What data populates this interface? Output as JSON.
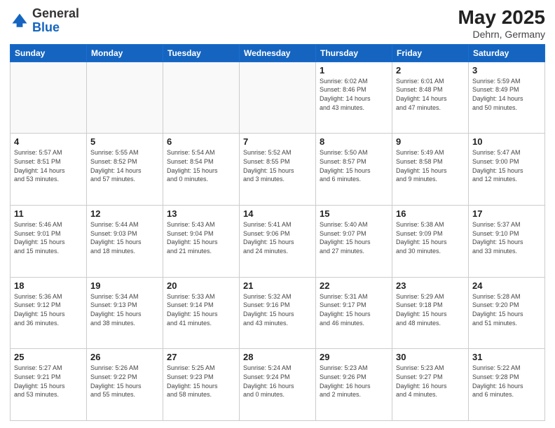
{
  "header": {
    "logo_general": "General",
    "logo_blue": "Blue",
    "month": "May 2025",
    "location": "Dehrn, Germany"
  },
  "weekdays": [
    "Sunday",
    "Monday",
    "Tuesday",
    "Wednesday",
    "Thursday",
    "Friday",
    "Saturday"
  ],
  "weeks": [
    [
      {
        "day": "",
        "info": ""
      },
      {
        "day": "",
        "info": ""
      },
      {
        "day": "",
        "info": ""
      },
      {
        "day": "",
        "info": ""
      },
      {
        "day": "1",
        "info": "Sunrise: 6:02 AM\nSunset: 8:46 PM\nDaylight: 14 hours\nand 43 minutes."
      },
      {
        "day": "2",
        "info": "Sunrise: 6:01 AM\nSunset: 8:48 PM\nDaylight: 14 hours\nand 47 minutes."
      },
      {
        "day": "3",
        "info": "Sunrise: 5:59 AM\nSunset: 8:49 PM\nDaylight: 14 hours\nand 50 minutes."
      }
    ],
    [
      {
        "day": "4",
        "info": "Sunrise: 5:57 AM\nSunset: 8:51 PM\nDaylight: 14 hours\nand 53 minutes."
      },
      {
        "day": "5",
        "info": "Sunrise: 5:55 AM\nSunset: 8:52 PM\nDaylight: 14 hours\nand 57 minutes."
      },
      {
        "day": "6",
        "info": "Sunrise: 5:54 AM\nSunset: 8:54 PM\nDaylight: 15 hours\nand 0 minutes."
      },
      {
        "day": "7",
        "info": "Sunrise: 5:52 AM\nSunset: 8:55 PM\nDaylight: 15 hours\nand 3 minutes."
      },
      {
        "day": "8",
        "info": "Sunrise: 5:50 AM\nSunset: 8:57 PM\nDaylight: 15 hours\nand 6 minutes."
      },
      {
        "day": "9",
        "info": "Sunrise: 5:49 AM\nSunset: 8:58 PM\nDaylight: 15 hours\nand 9 minutes."
      },
      {
        "day": "10",
        "info": "Sunrise: 5:47 AM\nSunset: 9:00 PM\nDaylight: 15 hours\nand 12 minutes."
      }
    ],
    [
      {
        "day": "11",
        "info": "Sunrise: 5:46 AM\nSunset: 9:01 PM\nDaylight: 15 hours\nand 15 minutes."
      },
      {
        "day": "12",
        "info": "Sunrise: 5:44 AM\nSunset: 9:03 PM\nDaylight: 15 hours\nand 18 minutes."
      },
      {
        "day": "13",
        "info": "Sunrise: 5:43 AM\nSunset: 9:04 PM\nDaylight: 15 hours\nand 21 minutes."
      },
      {
        "day": "14",
        "info": "Sunrise: 5:41 AM\nSunset: 9:06 PM\nDaylight: 15 hours\nand 24 minutes."
      },
      {
        "day": "15",
        "info": "Sunrise: 5:40 AM\nSunset: 9:07 PM\nDaylight: 15 hours\nand 27 minutes."
      },
      {
        "day": "16",
        "info": "Sunrise: 5:38 AM\nSunset: 9:09 PM\nDaylight: 15 hours\nand 30 minutes."
      },
      {
        "day": "17",
        "info": "Sunrise: 5:37 AM\nSunset: 9:10 PM\nDaylight: 15 hours\nand 33 minutes."
      }
    ],
    [
      {
        "day": "18",
        "info": "Sunrise: 5:36 AM\nSunset: 9:12 PM\nDaylight: 15 hours\nand 36 minutes."
      },
      {
        "day": "19",
        "info": "Sunrise: 5:34 AM\nSunset: 9:13 PM\nDaylight: 15 hours\nand 38 minutes."
      },
      {
        "day": "20",
        "info": "Sunrise: 5:33 AM\nSunset: 9:14 PM\nDaylight: 15 hours\nand 41 minutes."
      },
      {
        "day": "21",
        "info": "Sunrise: 5:32 AM\nSunset: 9:16 PM\nDaylight: 15 hours\nand 43 minutes."
      },
      {
        "day": "22",
        "info": "Sunrise: 5:31 AM\nSunset: 9:17 PM\nDaylight: 15 hours\nand 46 minutes."
      },
      {
        "day": "23",
        "info": "Sunrise: 5:29 AM\nSunset: 9:18 PM\nDaylight: 15 hours\nand 48 minutes."
      },
      {
        "day": "24",
        "info": "Sunrise: 5:28 AM\nSunset: 9:20 PM\nDaylight: 15 hours\nand 51 minutes."
      }
    ],
    [
      {
        "day": "25",
        "info": "Sunrise: 5:27 AM\nSunset: 9:21 PM\nDaylight: 15 hours\nand 53 minutes."
      },
      {
        "day": "26",
        "info": "Sunrise: 5:26 AM\nSunset: 9:22 PM\nDaylight: 15 hours\nand 55 minutes."
      },
      {
        "day": "27",
        "info": "Sunrise: 5:25 AM\nSunset: 9:23 PM\nDaylight: 15 hours\nand 58 minutes."
      },
      {
        "day": "28",
        "info": "Sunrise: 5:24 AM\nSunset: 9:24 PM\nDaylight: 16 hours\nand 0 minutes."
      },
      {
        "day": "29",
        "info": "Sunrise: 5:23 AM\nSunset: 9:26 PM\nDaylight: 16 hours\nand 2 minutes."
      },
      {
        "day": "30",
        "info": "Sunrise: 5:23 AM\nSunset: 9:27 PM\nDaylight: 16 hours\nand 4 minutes."
      },
      {
        "day": "31",
        "info": "Sunrise: 5:22 AM\nSunset: 9:28 PM\nDaylight: 16 hours\nand 6 minutes."
      }
    ]
  ]
}
